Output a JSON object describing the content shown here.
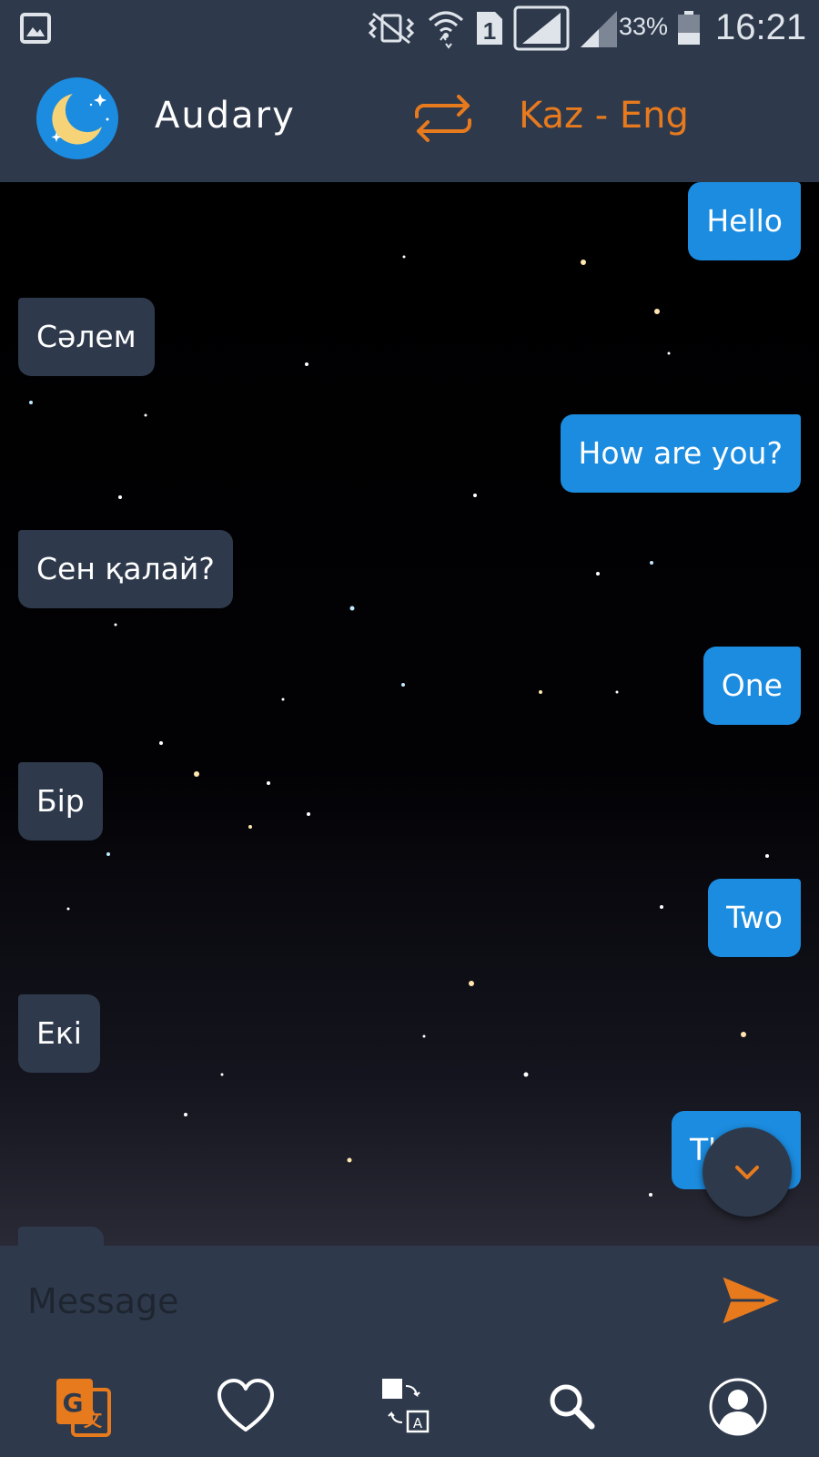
{
  "status_bar": {
    "battery_percent": "33%",
    "time": "16:21",
    "sim_slot": "1",
    "icons": [
      "gallery-icon",
      "mute-vibrate-icon",
      "wifi-icon",
      "sim-1-icon",
      "signal-icon",
      "signal-weak-icon",
      "battery-icon"
    ]
  },
  "app_bar": {
    "title": "Audary",
    "language_pair": "Kaz - Eng",
    "swap_icon": "swap-arrows-icon",
    "logo_icon": "moon-logo-icon"
  },
  "messages": [
    {
      "direction": "out",
      "text": "Hello"
    },
    {
      "direction": "in",
      "text": "Сәлем"
    },
    {
      "direction": "out",
      "text": "How are you?"
    },
    {
      "direction": "in",
      "text": "Сен қалай?"
    },
    {
      "direction": "out",
      "text": "One"
    },
    {
      "direction": "in",
      "text": "Бір"
    },
    {
      "direction": "out",
      "text": "Two"
    },
    {
      "direction": "in",
      "text": "Екі"
    },
    {
      "direction": "out",
      "text": "Th"
    }
  ],
  "composer": {
    "placeholder": "Message",
    "value": ""
  },
  "bottom_nav": [
    {
      "name": "translate",
      "icon": "google-translate-icon",
      "active": true
    },
    {
      "name": "favorites",
      "icon": "heart-icon",
      "active": false
    },
    {
      "name": "flashcards",
      "icon": "card-swap-icon",
      "active": false
    },
    {
      "name": "search",
      "icon": "search-icon",
      "active": false
    },
    {
      "name": "profile",
      "icon": "user-icon",
      "active": false
    }
  ],
  "colors": {
    "bar_background": "#2e3a4c",
    "accent": "#e87a1e",
    "outgoing_bubble": "#1c8ce0",
    "incoming_bubble": "#2e3a4c"
  }
}
